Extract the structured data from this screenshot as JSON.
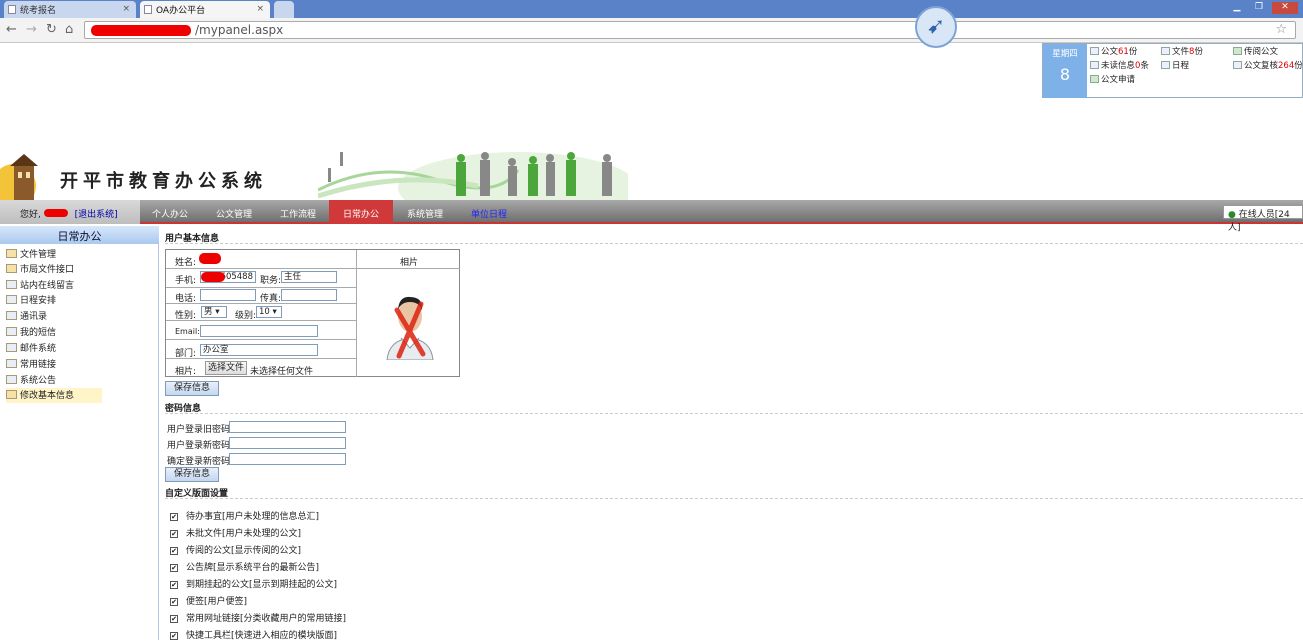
{
  "browser": {
    "tabs": [
      {
        "title": "统考报名",
        "active": false
      },
      {
        "title": "OA办公平台",
        "active": true
      }
    ],
    "url_suffix": "/mypanel.aspx"
  },
  "info_panel": {
    "weekday": "星期四",
    "day": "8",
    "items": [
      {
        "label": "公文",
        "count": "61",
        "suffix": "份"
      },
      {
        "label": "文件",
        "count": "8",
        "suffix": "份"
      },
      {
        "label": "传阅公文"
      },
      {
        "label": "未读信息",
        "count": "0",
        "suffix": "条"
      },
      {
        "label": "日程"
      },
      {
        "label": "公文复核",
        "count": "264",
        "suffix": "份"
      },
      {
        "label": "公文申请"
      }
    ]
  },
  "header": {
    "system_title": "开平市教育办公系统"
  },
  "navbar": {
    "greeting": "您好,",
    "logout": "[退出系统]",
    "menu": [
      "个人办公",
      "公文管理",
      "工作流程",
      "日常办公",
      "系统管理",
      "单位日程"
    ],
    "active_menu": "日常办公",
    "online": "在线人员[24人]"
  },
  "sidebar": {
    "title": "日常办公",
    "items": [
      "文件管理",
      "市局文件接口",
      "站内在线留言",
      "日程安排",
      "通讯录",
      "我的短信",
      "邮件系统",
      "常用链接",
      "系统公告",
      "修改基本信息"
    ],
    "active": "修改基本信息"
  },
  "basic_info": {
    "section_title": "用户基本信息",
    "name_label": "姓名:",
    "phone_label": "手机:",
    "phone_value": "605488",
    "position_label": "职务:",
    "position_value": "主任",
    "tel_label": "电话:",
    "fax_label": "传真:",
    "gender_label": "性别:",
    "gender_value": "男",
    "level_label": "级别:",
    "level_value": "10",
    "email_label": "Email:",
    "dept_label": "部门:",
    "dept_value": "办公室",
    "photo_label": "相片:",
    "file_button": "选择文件",
    "file_status": "未选择任何文件",
    "photo_header": "相片",
    "save_button": "保存信息"
  },
  "password": {
    "section_title": "密码信息",
    "old_label": "用户登录旧密码:",
    "new_label": "用户登录新密码:",
    "confirm_label": "确定登录新密码:",
    "save_button": "保存信息"
  },
  "custom": {
    "section_title": "自定义版面设置",
    "options": [
      "待办事宜[用户未处理的信息总汇]",
      "未批文件[用户未处理的公文]",
      "传阅的公文[显示传阅的公文]",
      "公告牌[显示系统平台的最新公告]",
      "到期挂起的公文[显示到期挂起的公文]",
      "便签[用户便签]",
      "常用网址链接[分类收藏用户的常用链接]",
      "快捷工具栏[快速进入相应的模块版面]"
    ]
  }
}
